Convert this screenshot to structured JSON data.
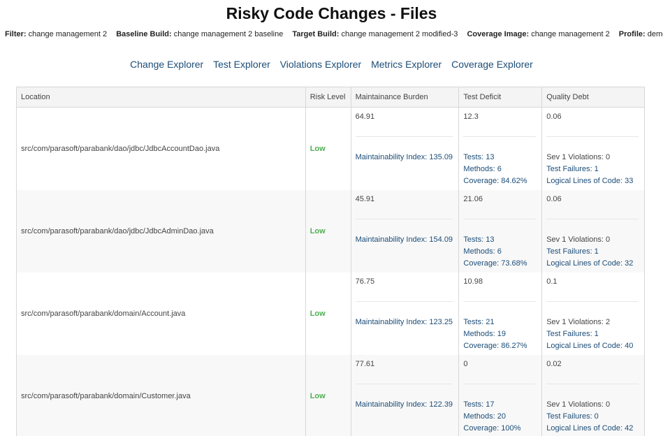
{
  "title": "Risky Code Changes - Files",
  "filters": [
    {
      "label": "Filter:",
      "value": "change management 2"
    },
    {
      "label": "Baseline Build:",
      "value": "change management 2 baseline"
    },
    {
      "label": "Target Build:",
      "value": "change management 2 modified-3"
    },
    {
      "label": "Coverage Image:",
      "value": "change management 2"
    },
    {
      "label": "Profile:",
      "value": "demo"
    }
  ],
  "nav": [
    "Change Explorer",
    "Test Explorer",
    "Violations Explorer",
    "Metrics Explorer",
    "Coverage Explorer"
  ],
  "table": {
    "headers": [
      "Location",
      "Risk Level",
      "Maintainance Burden",
      "Test Deficit",
      "Quality Debt"
    ],
    "rows": [
      {
        "location": "src/com/parasoft/parabank/dao/jdbc/JdbcAccountDao.java",
        "risk": "Low",
        "burden": "64.91",
        "mi": "Maintainability Index: 135.09",
        "deficit": "12.3",
        "tests": "Tests: 13",
        "methods": "Methods: 6",
        "coverage": "Coverage: 84.62%",
        "debt": "0.06",
        "sev1": "Sev 1 Violations: 0",
        "failures": "Test Failures: 1",
        "lloc": "Logical Lines of Code: 33"
      },
      {
        "location": "src/com/parasoft/parabank/dao/jdbc/JdbcAdminDao.java",
        "risk": "Low",
        "burden": "45.91",
        "mi": "Maintainability Index: 154.09",
        "deficit": "21.06",
        "tests": "Tests: 13",
        "methods": "Methods: 6",
        "coverage": "Coverage: 73.68%",
        "debt": "0.06",
        "sev1": "Sev 1 Violations: 0",
        "failures": "Test Failures: 1",
        "lloc": "Logical Lines of Code: 32"
      },
      {
        "location": "src/com/parasoft/parabank/domain/Account.java",
        "risk": "Low",
        "burden": "76.75",
        "mi": "Maintainability Index: 123.25",
        "deficit": "10.98",
        "tests": "Tests: 21",
        "methods": "Methods: 19",
        "coverage": "Coverage: 86.27%",
        "debt": "0.1",
        "sev1": "Sev 1 Violations: 2",
        "failures": "Test Failures: 1",
        "lloc": "Logical Lines of Code: 40"
      },
      {
        "location": "src/com/parasoft/parabank/domain/Customer.java",
        "risk": "Low",
        "burden": "77.61",
        "mi": "Maintainability Index: 122.39",
        "deficit": "0",
        "tests": "Tests: 17",
        "methods": "Methods: 20",
        "coverage": "Coverage: 100%",
        "debt": "0.02",
        "sev1": "Sev 1 Violations: 0",
        "failures": "Test Failures: 0",
        "lloc": "Logical Lines of Code: 42"
      }
    ]
  }
}
